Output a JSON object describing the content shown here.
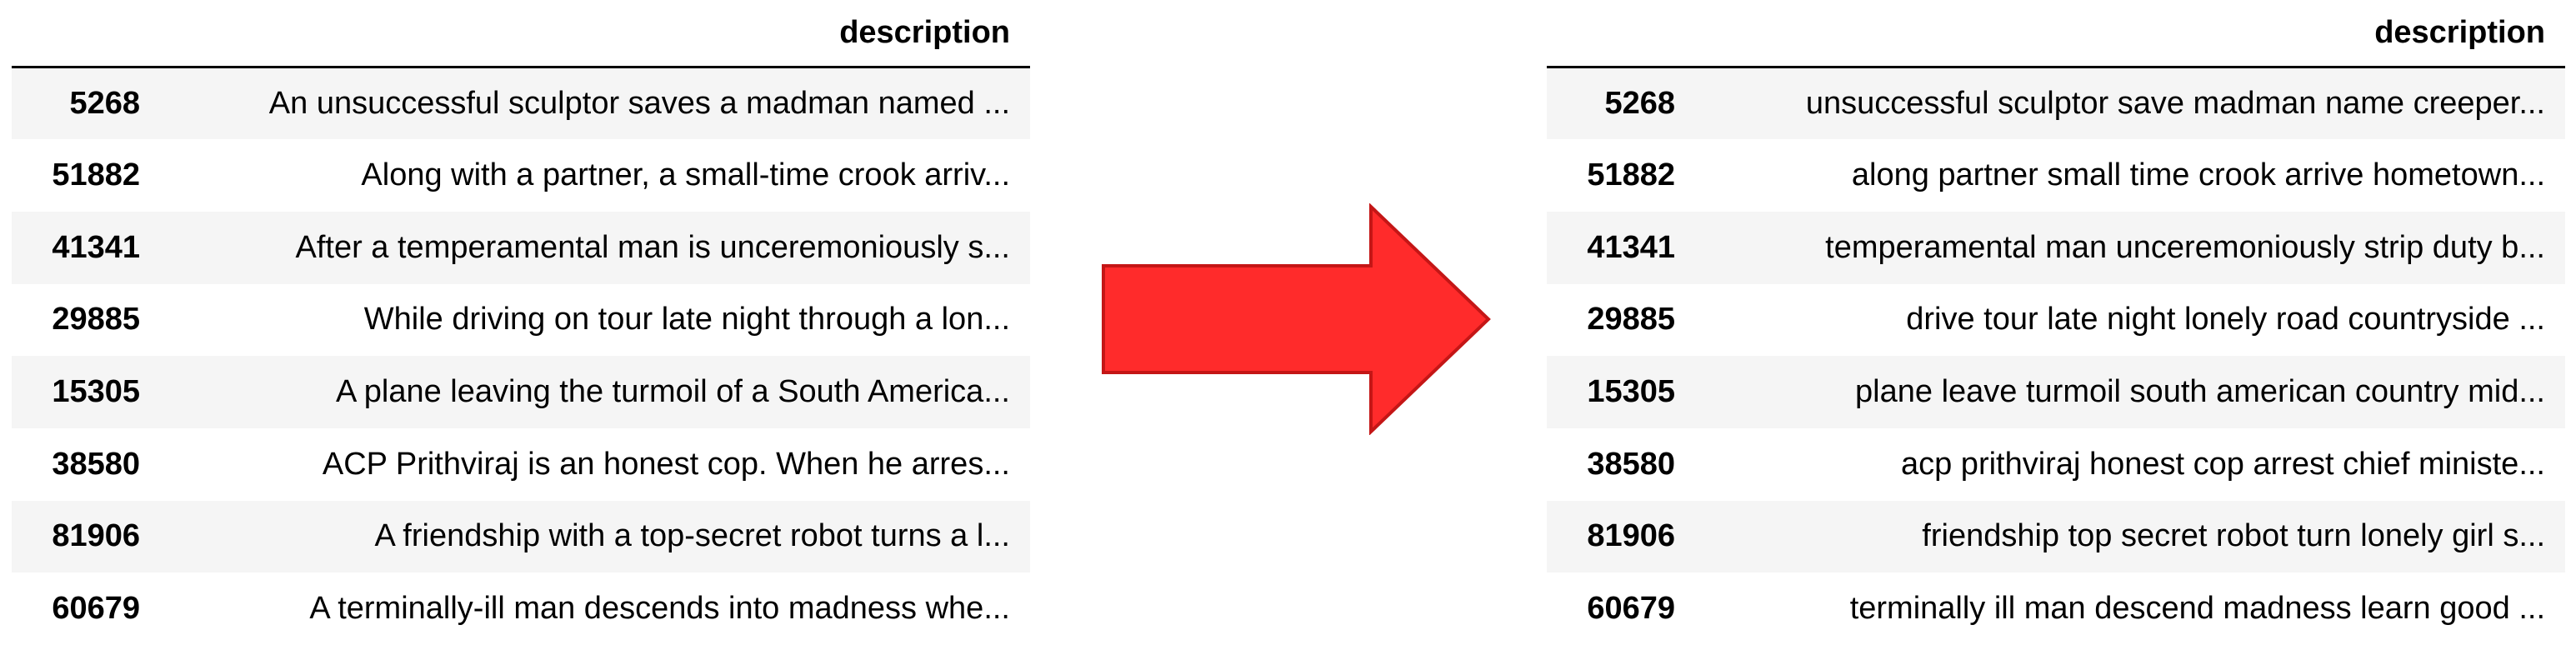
{
  "column_header": "description",
  "colors": {
    "arrow_fill": "#ff2b2b",
    "arrow_stroke": "#c41616",
    "row_stripe": "#f5f5f5"
  },
  "left_table": {
    "rows": [
      {
        "index": "5268",
        "description": "An unsuccessful sculptor saves a madman named ..."
      },
      {
        "index": "51882",
        "description": "Along with a partner, a small-time crook arriv..."
      },
      {
        "index": "41341",
        "description": "After a temperamental man is unceremoniously s..."
      },
      {
        "index": "29885",
        "description": "While driving on tour late night through a lon..."
      },
      {
        "index": "15305",
        "description": "A plane leaving the turmoil of a South America..."
      },
      {
        "index": "38580",
        "description": "ACP Prithviraj is an honest cop. When he arres..."
      },
      {
        "index": "81906",
        "description": "A friendship with a top-secret robot turns a l..."
      },
      {
        "index": "60679",
        "description": "A terminally-ill man descends into madness whe..."
      }
    ]
  },
  "right_table": {
    "rows": [
      {
        "index": "5268",
        "description": "unsuccessful sculptor save madman name creeper..."
      },
      {
        "index": "51882",
        "description": "along partner small time crook arrive hometown..."
      },
      {
        "index": "41341",
        "description": "temperamental man unceremoniously strip duty b..."
      },
      {
        "index": "29885",
        "description": "drive tour late night lonely road countryside ..."
      },
      {
        "index": "15305",
        "description": "plane leave turmoil south american country mid..."
      },
      {
        "index": "38580",
        "description": "acp prithviraj honest cop arrest chief ministe..."
      },
      {
        "index": "81906",
        "description": "friendship top secret robot turn lonely girl s..."
      },
      {
        "index": "60679",
        "description": "terminally ill man descend madness learn good ..."
      }
    ]
  },
  "arrow_icon": "right-arrow-icon"
}
